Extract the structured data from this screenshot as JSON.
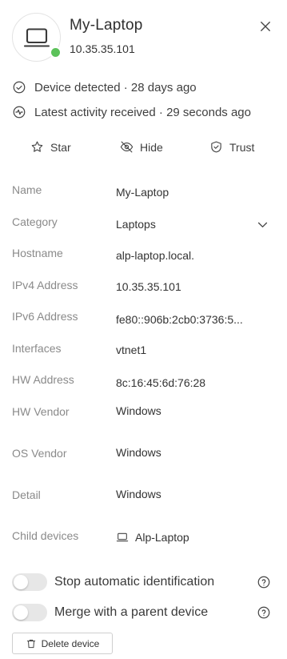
{
  "device": {
    "name": "My-Laptop",
    "ip": "10.35.35.101",
    "online": true,
    "status_color": "#5cc25a"
  },
  "status": {
    "detected": "Device detected · 28 days ago",
    "activity": "Latest activity received · 29 seconds ago"
  },
  "actions": {
    "star": "Star",
    "hide": "Hide",
    "trust": "Trust"
  },
  "fields": {
    "name": {
      "label": "Name",
      "value": "My-Laptop"
    },
    "category": {
      "label": "Category",
      "value": "Laptops"
    },
    "hostname": {
      "label": "Hostname",
      "value": "alp-laptop.local."
    },
    "ipv4": {
      "label": "IPv4 Address",
      "value": "10.35.35.101"
    },
    "ipv6": {
      "label": "IPv6 Address",
      "value": "fe80::906b:2cb0:3736:5..."
    },
    "interfaces": {
      "label": "Interfaces",
      "value": "vtnet1"
    },
    "hw_address": {
      "label": "HW Address",
      "value": "8c:16:45:6d:76:28"
    },
    "hw_vendor": {
      "label": "HW Vendor",
      "value": "Windows"
    },
    "os_vendor": {
      "label": "OS Vendor",
      "value": "Windows"
    },
    "detail": {
      "label": "Detail",
      "value": "Windows"
    },
    "child_devices": {
      "label": "Child devices",
      "value": "Alp-Laptop"
    }
  },
  "toggles": {
    "stop_identification": "Stop automatic identification",
    "merge_parent": "Merge with a parent device"
  },
  "delete_label": "Delete device",
  "icons": {
    "avatar": "laptop-icon",
    "close": "close-icon",
    "detected": "check-circle-icon",
    "activity": "activity-icon",
    "star": "star-icon",
    "hide": "eye-off-icon",
    "trust": "shield-check-icon",
    "category_dropdown": "chevron-down-icon",
    "child_device": "laptop-icon",
    "help": "help-circle-icon",
    "delete": "trash-icon"
  }
}
